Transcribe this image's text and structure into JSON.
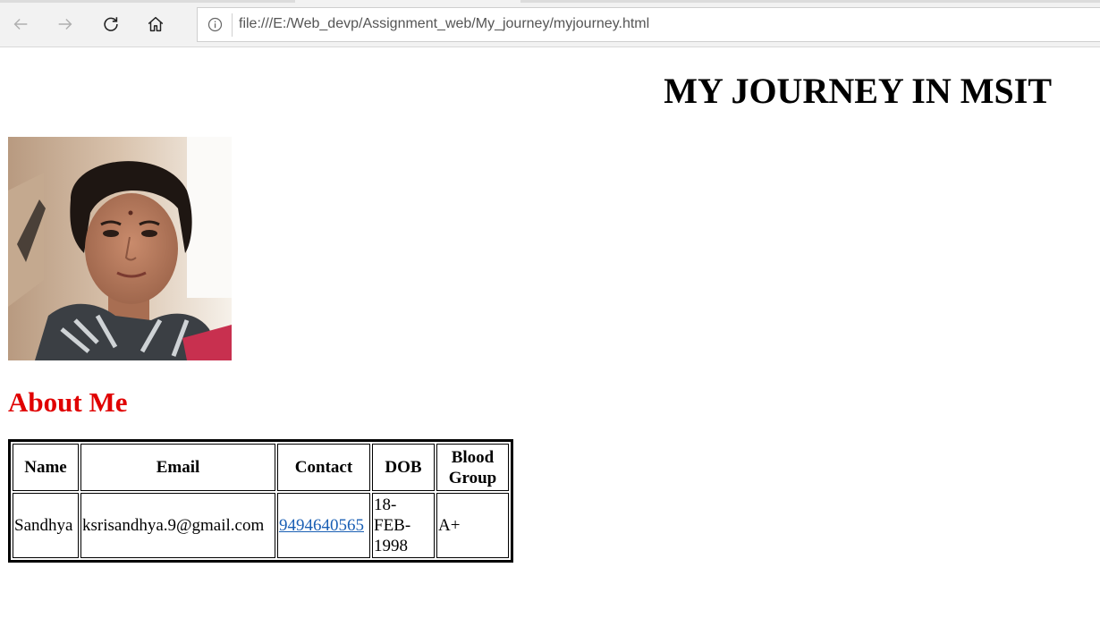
{
  "browser": {
    "url": "file:///E:/Web_devp/Assignment_web/My_journey/myjourney.html"
  },
  "page": {
    "title": "MY JOURNEY IN MSIT",
    "section_heading": "About Me",
    "section_heading_color": "#e00000"
  },
  "table": {
    "headers": {
      "name": "Name",
      "email": "Email",
      "contact": "Contact",
      "dob": "DOB",
      "blood_group_line1": "Blood",
      "blood_group_line2": "Group"
    },
    "row": {
      "name": "Sandhya",
      "email": "ksrisandhya.9@gmail.com",
      "contact": "9494640565",
      "dob_line1": "18-",
      "dob_line2": "FEB-",
      "dob_line3": "1998",
      "blood_group": "A+"
    }
  },
  "colors": {
    "link": "#1a5fb4"
  }
}
